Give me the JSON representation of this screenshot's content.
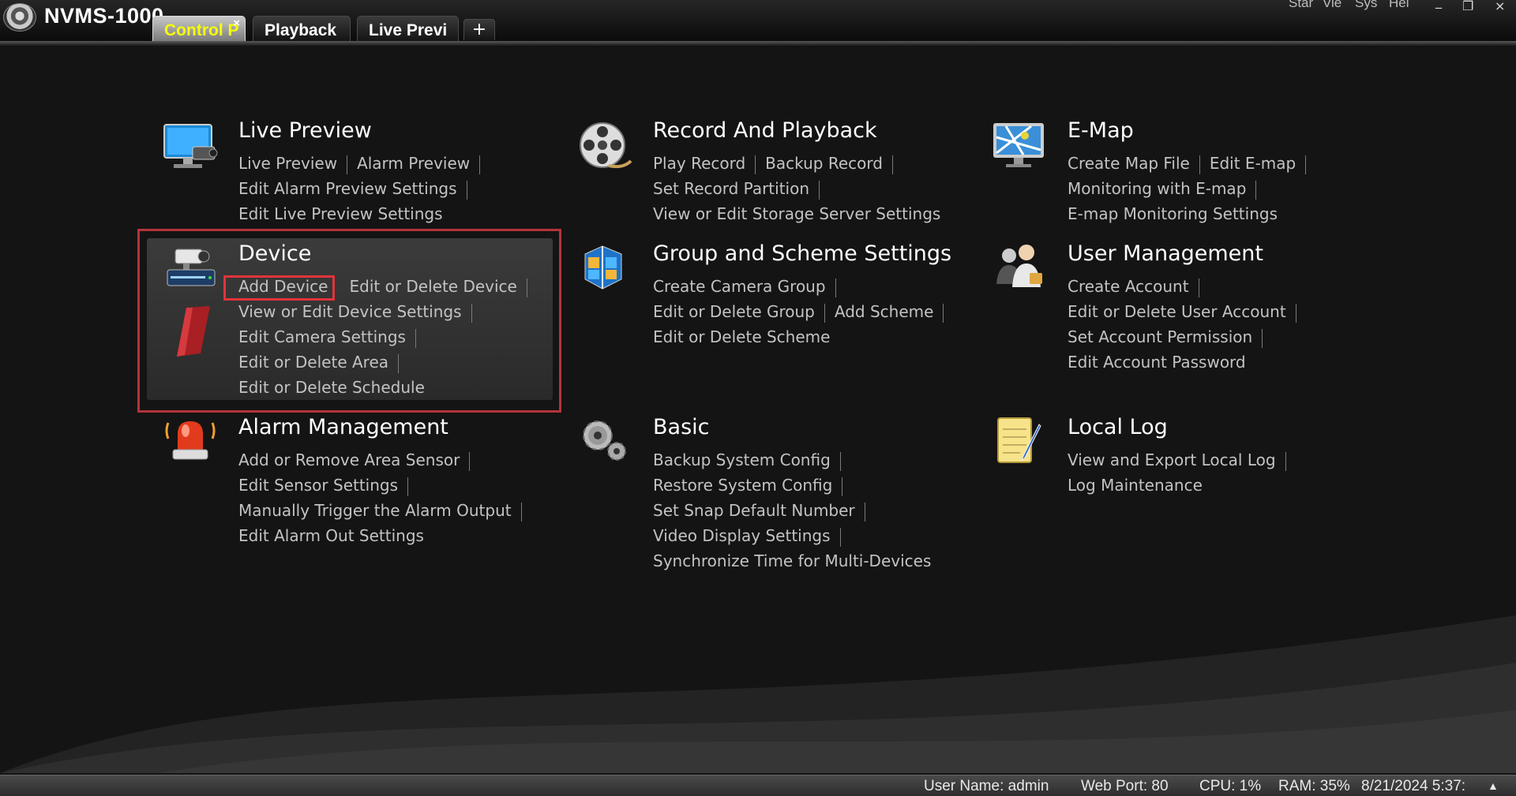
{
  "app": {
    "title": "NVMS-1000"
  },
  "tabs": [
    {
      "label": "Control P",
      "active": true,
      "close": "×"
    },
    {
      "label": "Playback",
      "active": false
    },
    {
      "label": "Live Previ",
      "active": false
    }
  ],
  "tab_add": "+",
  "top_menu": [
    "Star",
    "Vie",
    "Sys",
    "Hel"
  ],
  "window_controls": [
    "_",
    "❐",
    "×"
  ],
  "sections": {
    "live_preview": {
      "title": "Live Preview",
      "links": [
        "Live Preview",
        "Alarm Preview",
        "Edit Alarm Preview Settings",
        "Edit Live Preview Settings"
      ]
    },
    "record_playback": {
      "title": "Record And Playback",
      "links": [
        "Play Record",
        "Backup Record",
        "Set Record Partition",
        "View or Edit Storage Server Settings"
      ]
    },
    "emap": {
      "title": "E-Map",
      "links": [
        "Create Map File",
        "Edit E-map",
        "Monitoring with E-map",
        "E-map Monitoring Settings"
      ]
    },
    "device": {
      "title": "Device",
      "links": [
        "Add Device",
        "Edit or Delete Device",
        "View or Edit Device Settings",
        "Edit Camera Settings",
        "Edit or Delete Area",
        "Edit or Delete Schedule"
      ]
    },
    "group_scheme": {
      "title": "Group and Scheme Settings",
      "links": [
        "Create Camera Group",
        "Edit or Delete Group",
        "Add Scheme",
        "Edit or Delete Scheme"
      ]
    },
    "user_management": {
      "title": "User Management",
      "links": [
        "Create Account",
        "Edit or Delete User Account",
        "Set Account Permission",
        "Edit Account Password"
      ]
    },
    "alarm_management": {
      "title": "Alarm Management",
      "links": [
        "Add or Remove Area Sensor",
        "Edit Sensor Settings",
        "Manually Trigger the Alarm Output",
        "Edit Alarm Out Settings"
      ]
    },
    "basic": {
      "title": "Basic",
      "links": [
        "Backup System Config",
        "Restore System Config",
        "Set Snap Default Number",
        "Video Display Settings",
        "Synchronize Time for Multi-Devices"
      ]
    },
    "local_log": {
      "title": "Local Log",
      "links": [
        "View and Export Local Log",
        "Log Maintenance"
      ]
    }
  },
  "status_bar": {
    "user": "User Name: admin",
    "web_port": "Web Port: 80",
    "cpu": "CPU: 1%",
    "ram": "RAM: 35%",
    "datetime": "8/21/2024 5:37:",
    "arrow": "▲"
  },
  "icons": {
    "live_preview": "monitor-camera-icon",
    "record_playback": "film-reel-icon",
    "emap": "map-monitor-icon",
    "device": "device-camera-icon",
    "group_scheme": "cube-group-icon",
    "user_management": "user-group-icon",
    "alarm_management": "alarm-siren-icon",
    "basic": "gears-icon",
    "local_log": "notepad-pen-icon"
  },
  "colors": {
    "background": "#141414",
    "link": "#c3c3c3",
    "active_tab_text": "#f6ff00",
    "highlight_box": "#b3343a",
    "highlight_item": "#e0343c"
  }
}
